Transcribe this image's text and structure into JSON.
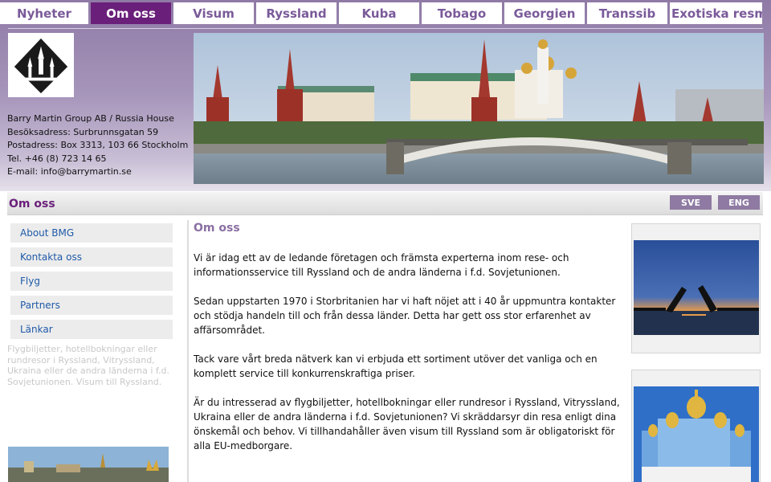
{
  "nav": {
    "tabs": [
      {
        "label": "Nyheter"
      },
      {
        "label": "Om oss"
      },
      {
        "label": "Visum"
      },
      {
        "label": "Ryssland"
      },
      {
        "label": "Kuba"
      },
      {
        "label": "Tobago"
      },
      {
        "label": "Georgien"
      },
      {
        "label": "Transsib"
      },
      {
        "label": "Exotiska resmål"
      }
    ],
    "active": "Om oss"
  },
  "contact": {
    "company": "Barry Martin Group AB / Russia House",
    "visit": "Besöksadress: Surbrunnsgatan 59",
    "post": "Postadress: Box 3313, 103 66 Stockholm",
    "phone": "Tel. +46 (8) 723 14 65",
    "email": "E-mail: info@barrymartin.se"
  },
  "titlebar": {
    "title": "Om oss",
    "lang_sve": "SVE",
    "lang_eng": "ENG"
  },
  "sidebar": {
    "items": [
      {
        "label": "About BMG"
      },
      {
        "label": "Kontakta oss"
      },
      {
        "label": "Flyg"
      },
      {
        "label": "Partners"
      },
      {
        "label": "Länkar"
      }
    ],
    "blurb": "Flygbiljetter, hotellbokningar eller rundresor i Ryssland, Vitryssland, Ukraina eller de andra länderna i f.d. Sovjetunionen. Visum till Ryssland."
  },
  "main": {
    "heading": "Om oss",
    "paragraphs": [
      "Vi är idag ett av de ledande företagen och främsta experterna inom rese- och informationsservice till Ryssland och de andra länderna i f.d. Sovjetunionen.",
      "Sedan uppstarten 1970 i Storbritanien har vi haft nöjet att i 40 år uppmuntra kontakter och stödja handeln till och från dessa länder.  Detta har gett oss stor erfarenhet av affärsområdet.",
      "Tack vare vårt breda nätverk kan vi erbjuda ett sortiment utöver det vanliga och en komplett service till konkurrenskraftiga priser.",
      "Är du intresserad av flygbiljetter, hotellbokningar eller rundresor i Ryssland, Vitryssland, Ukraina eller de andra länderna i f.d. Sovjetunionen? Vi skräddarsyr din resa enligt dina önskemål och behov. Vi tillhandahåller även visum till Ryssland som är obligatoriskt för alla EU-medborgare."
    ]
  },
  "colors": {
    "brand_purple": "#6a1f7a",
    "link_blue": "#1f5aa8",
    "header_lilac": "#8f7aa6"
  }
}
